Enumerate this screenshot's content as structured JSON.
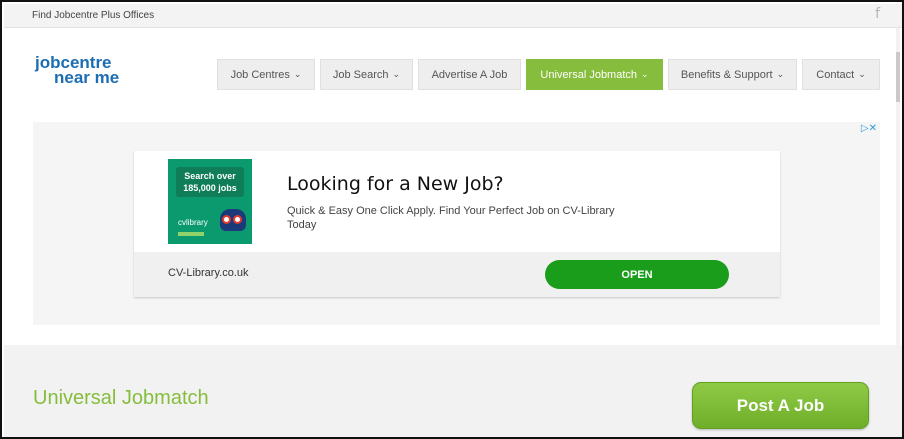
{
  "topbar": {
    "link": "Find Jobcentre Plus Offices",
    "social_icon": "f"
  },
  "logo": {
    "line1": "jobcentre",
    "line2": "near me"
  },
  "nav": {
    "items": [
      {
        "label": "Job Centres",
        "chevron": "⌄"
      },
      {
        "label": "Job Search",
        "chevron": "⌄"
      },
      {
        "label": "Advertise A Job",
        "chevron": ""
      },
      {
        "label": "Universal Jobmatch",
        "chevron": "⌄",
        "active": true
      },
      {
        "label": "Benefits & Support",
        "chevron": "⌄"
      },
      {
        "label": "Contact",
        "chevron": "⌄"
      }
    ]
  },
  "ad": {
    "close_label": "▷✕",
    "image_line1": "Search over",
    "image_line2": "185,000 jobs",
    "image_brand": "cvlibrary",
    "title": "Looking for a New Job?",
    "description": "Quick & Easy One Click Apply. Find Your Perfect Job on CV-Library Today",
    "domain": "CV-Library.co.uk",
    "open_label": "OPEN"
  },
  "section": {
    "title": "Universal Jobmatch",
    "post_button": "Post A Job"
  },
  "colors": {
    "accent_green": "#86bd3c",
    "brand_blue": "#1d6db3",
    "open_green": "#1a9d1a"
  }
}
